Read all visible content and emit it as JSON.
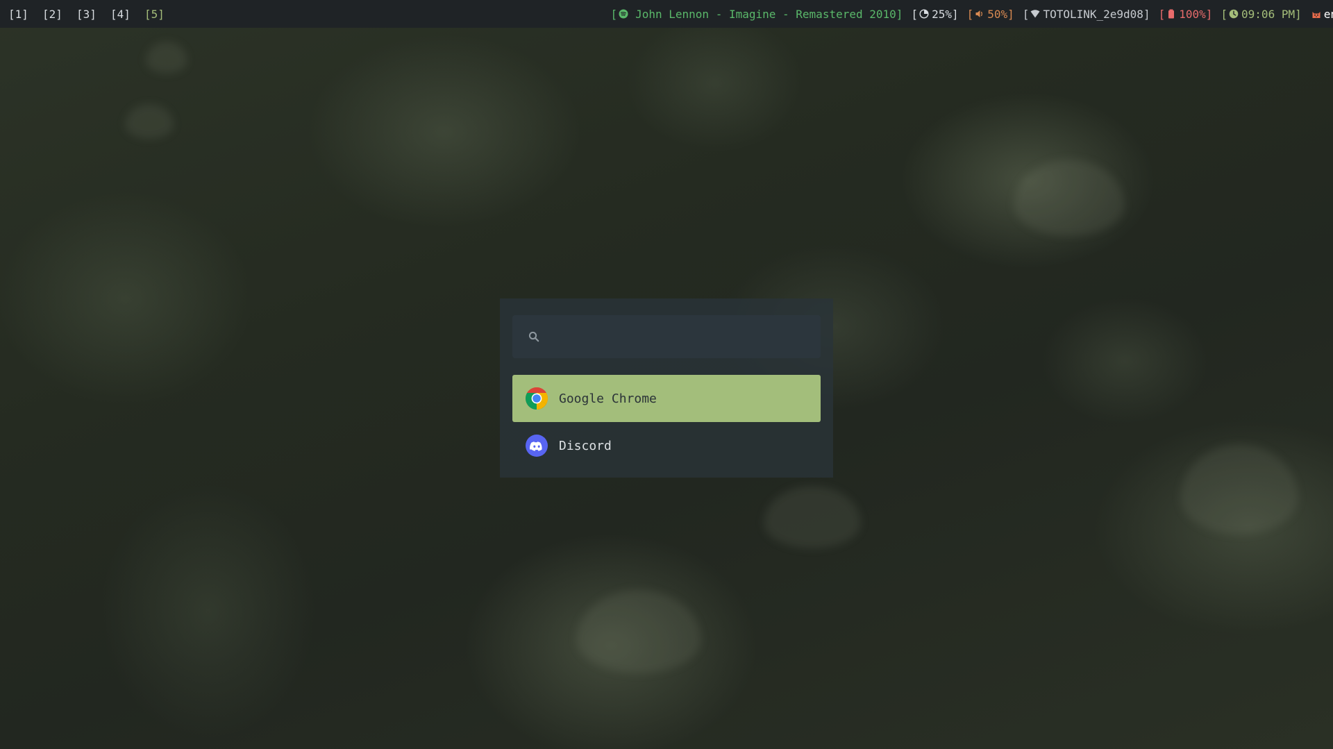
{
  "workspaces": [
    "[1]",
    "[2]",
    "[3]",
    "[4]",
    "[5]"
  ],
  "status": {
    "music": {
      "open": "[",
      "text": "John Lennon - Imagine - Remastered 2010",
      "close": "]",
      "icon": "spotify-icon"
    },
    "cpu": {
      "open": "[",
      "text": "25%",
      "close": "]",
      "icon": "pie-chart-icon"
    },
    "volume": {
      "open": "[",
      "text": "50%",
      "close": "]",
      "icon": "speaker-icon"
    },
    "wifi": {
      "open": "[",
      "text": "TOTOLINK_2e9d08",
      "close": "]",
      "icon": "wifi-icon"
    },
    "battery": {
      "open": "[",
      "text": "100%",
      "close": "]",
      "icon": "battery-icon"
    },
    "clock": {
      "open": "[",
      "text": "09:06 PM",
      "close": "]",
      "icon": "clock-icon"
    },
    "language": {
      "text": "en",
      "icon": "keyboard-cat-icon"
    }
  },
  "launcher": {
    "search": {
      "value": "",
      "placeholder": ""
    },
    "results": [
      {
        "label": "Google Chrome",
        "icon": "chrome-icon",
        "selected": true
      },
      {
        "label": "Discord",
        "icon": "discord-icon",
        "selected": false
      }
    ]
  },
  "colors": {
    "bar_bg": "#1f2326",
    "active_workspace": "#a5be7a",
    "music": "#5ab86a",
    "volume": "#d98a52",
    "battery": "#e86b6b",
    "clock": "#a5be7a",
    "launcher_bg": "#2a3338",
    "search_bg": "#2c363d",
    "selected_item": "#a3be7b"
  }
}
